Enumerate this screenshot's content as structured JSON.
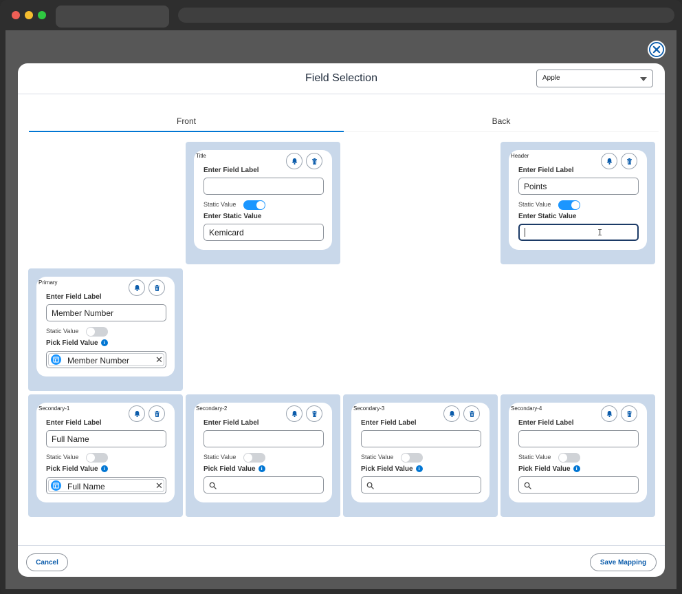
{
  "modal": {
    "title": "Field Selection",
    "org_select": "Apple"
  },
  "tabs": [
    {
      "label": "Front",
      "active": true
    },
    {
      "label": "Back",
      "active": false
    }
  ],
  "common": {
    "enter_field_label": "Enter Field Label",
    "static_value": "Static Value",
    "enter_static_value": "Enter Static Value",
    "pick_field_value": "Pick Field Value",
    "info": "i"
  },
  "zones": {
    "title": {
      "name": "Title",
      "field_label": "",
      "static_on": true,
      "static_value": "Kemicard"
    },
    "header": {
      "name": "Header",
      "field_label": "Points",
      "static_on": true,
      "static_value": ""
    },
    "primary": {
      "name": "Primary",
      "field_label": "Member Number",
      "static_on": false,
      "picked_value": "Member Number"
    },
    "secondary1": {
      "name": "Secondary-1",
      "field_label": "Full Name",
      "static_on": false,
      "picked_value": "Full Name"
    },
    "secondary2": {
      "name": "Secondary-2",
      "field_label": "",
      "static_on": false
    },
    "secondary3": {
      "name": "Secondary-3",
      "field_label": "",
      "static_on": false
    },
    "secondary4": {
      "name": "Secondary-4",
      "field_label": "",
      "static_on": false
    }
  },
  "footer": {
    "cancel_label": "Cancel",
    "save_label": "Save Mapping"
  },
  "colors": {
    "accent": "#0176d3",
    "toggle_on": "#1b96ff",
    "zone_bg": "#c9d8ea"
  }
}
